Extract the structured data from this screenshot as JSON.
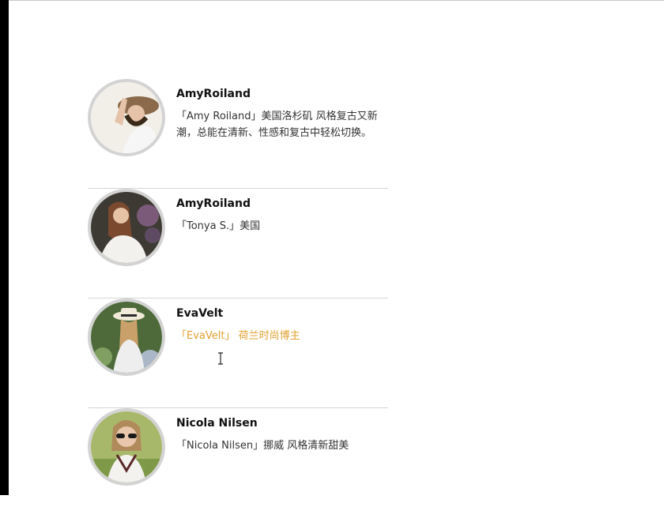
{
  "profiles": [
    {
      "name": "AmyRoiland",
      "description": "「Amy Roiland」美国洛杉矶 风格复古又新潮，总能在清新、性感和复古中轻松切换。"
    },
    {
      "name": "AmyRoiland",
      "description": "「Tonya S.」美国"
    },
    {
      "name": "EvaVelt",
      "description": "「EvaVelt」 荷兰时尚博主"
    },
    {
      "name": "Nicola Nilsen",
      "description": "「Nicola Nilsen」挪威 风格清新甜美"
    }
  ],
  "colors": {
    "hover_text": "#e0a030",
    "avatar_border": "#d3d3d3",
    "divider": "#d5d5d5"
  }
}
